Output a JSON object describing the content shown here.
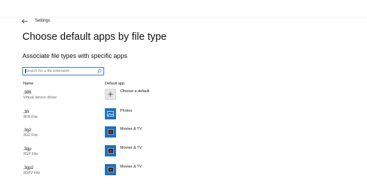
{
  "window": {
    "app_title": "Settings"
  },
  "page": {
    "title": "Choose default apps by file type",
    "section_title": "Associate file types with specific apps"
  },
  "search": {
    "placeholder": "Search for a file extension",
    "value": ""
  },
  "table": {
    "headers": {
      "name": "Name",
      "default_app": "Default app"
    },
    "rows": [
      {
        "extension": ".386",
        "description": "Virtual device driver",
        "app": "Choose a default",
        "app_icon": "plus-icon"
      },
      {
        "extension": ".3fr",
        "description": "3FR File",
        "app": "Photos",
        "app_icon": "photos-icon"
      },
      {
        "extension": ".3g2",
        "description": "3G2 File",
        "app": "Movies & TV",
        "app_icon": "movies-tv-icon"
      },
      {
        "extension": ".3gp",
        "description": "3GP File",
        "app": "Movies & TV",
        "app_icon": "movies-tv-icon"
      },
      {
        "extension": ".3gp2",
        "description": "3GP2 File",
        "app": "Movies & TV",
        "app_icon": "movies-tv-icon"
      }
    ]
  },
  "colors": {
    "accent": "#1e6fc0",
    "search_border": "#3c78d8",
    "default_tile": "#e6e6e6"
  }
}
